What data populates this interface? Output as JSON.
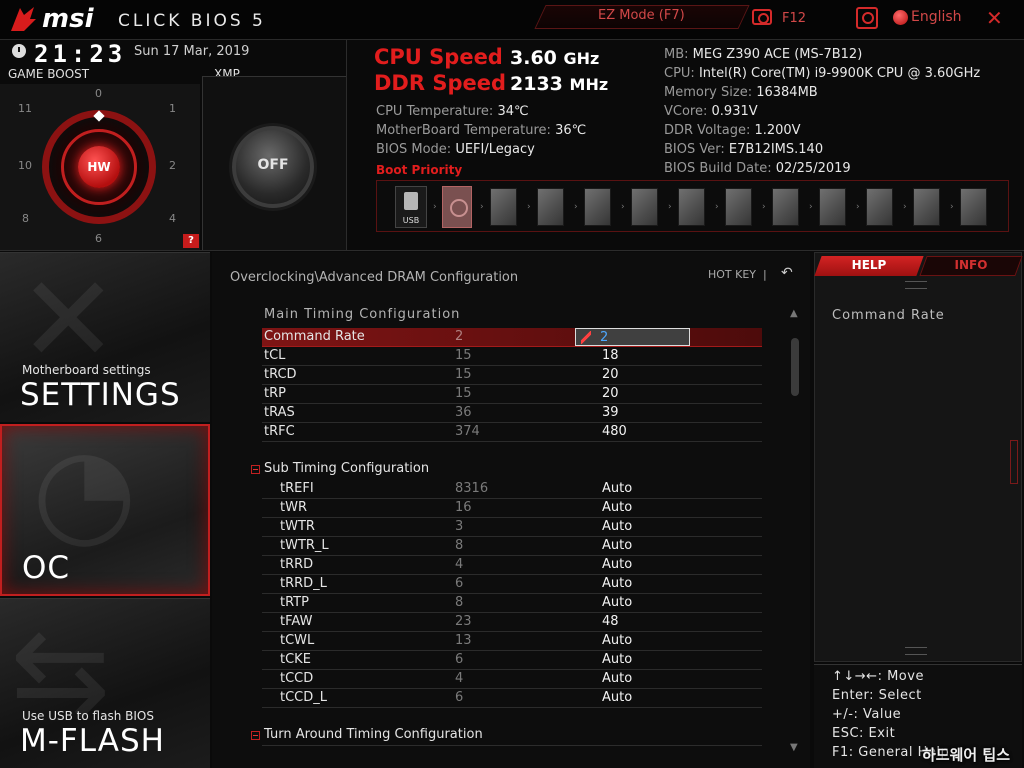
{
  "header": {
    "brand": "msi",
    "product": "CLICK BIOS 5",
    "ez_mode": "EZ Mode (F7)",
    "screenshot": "F12",
    "language": "English",
    "close": "✕"
  },
  "status": {
    "time": "21:23",
    "date": "Sun  17 Mar, 2019",
    "game_boost_label": "GAME BOOST",
    "xmp_label": "XMP",
    "dial_numbers": [
      "0",
      "1",
      "2",
      "4",
      "6",
      "8",
      "10",
      "11"
    ],
    "dial_core": "HW",
    "xmp_state": "OFF",
    "help_badge": "?"
  },
  "speeds": {
    "cpu_label": "CPU Speed",
    "cpu_value": "3.60",
    "cpu_unit": "GHz",
    "ddr_label": "DDR Speed",
    "ddr_value": "2133",
    "ddr_unit": "MHz"
  },
  "temps": {
    "cpu_temp_label": "CPU Temperature:",
    "cpu_temp_value": "34℃",
    "mb_temp_label": "MotherBoard Temperature:",
    "mb_temp_value": "36℃",
    "bios_mode_label": "BIOS Mode:",
    "bios_mode_value": "UEFI/",
    "bios_mode_legacy": "Legacy",
    "boot_priority": "Boot Priority",
    "usb_label": "USB"
  },
  "system": {
    "mb_label": "MB:",
    "mb_value": "MEG Z390 ACE (MS-7B12)",
    "cpu_label": "CPU:",
    "cpu_value": "Intel(R) Core(TM) i9-9900K CPU @ 3.60GHz",
    "mem_label": "Memory Size:",
    "mem_value": "16384MB",
    "vcore_label": "VCore:",
    "vcore_value": "0.931V",
    "ddrv_label": "DDR Voltage:",
    "ddrv_value": "1.200V",
    "biosver_label": "BIOS Ver:",
    "biosver_value": "E7B12IMS.140",
    "biosdate_label": "BIOS Build Date:",
    "biosdate_value": "02/25/2019"
  },
  "nav": {
    "settings_sub": "Motherboard settings",
    "settings_title": "SETTINGS",
    "oc_title": "OC",
    "mflash_sub": "Use USB to flash BIOS",
    "mflash_title": "M-FLASH"
  },
  "main": {
    "breadcrumb": "Overclocking\\Advanced DRAM Configuration",
    "hotkey": "HOT KEY",
    "hotkey_sep": "|",
    "undo": "↶",
    "main_timing_title": "Main  Timing  Configuration",
    "main_rows": [
      {
        "name": "Command Rate",
        "default": "2",
        "value": "2"
      },
      {
        "name": "tCL",
        "default": "15",
        "value": "18"
      },
      {
        "name": "tRCD",
        "default": "15",
        "value": "20"
      },
      {
        "name": "tRP",
        "default": "15",
        "value": "20"
      },
      {
        "name": "tRAS",
        "default": "36",
        "value": "39"
      },
      {
        "name": "tRFC",
        "default": "374",
        "value": "480"
      }
    ],
    "sub_timing_title": "Sub Timing Configuration",
    "sub_rows": [
      {
        "name": "tREFI",
        "default": "8316",
        "value": "Auto"
      },
      {
        "name": "tWR",
        "default": "16",
        "value": "Auto"
      },
      {
        "name": "tWTR",
        "default": "3",
        "value": "Auto"
      },
      {
        "name": "tWTR_L",
        "default": "8",
        "value": "Auto"
      },
      {
        "name": "tRRD",
        "default": "4",
        "value": "Auto"
      },
      {
        "name": "tRRD_L",
        "default": "6",
        "value": "Auto"
      },
      {
        "name": "tRTP",
        "default": "8",
        "value": "Auto"
      },
      {
        "name": "tFAW",
        "default": "23",
        "value": "48"
      },
      {
        "name": "tCWL",
        "default": "13",
        "value": "Auto"
      },
      {
        "name": "tCKE",
        "default": "6",
        "value": "Auto"
      },
      {
        "name": "tCCD",
        "default": "4",
        "value": "Auto"
      },
      {
        "name": "tCCD_L",
        "default": "6",
        "value": "Auto"
      }
    ],
    "turn_around_title": "Turn Around Timing Configuration"
  },
  "help": {
    "tab_help": "HELP",
    "tab_info": "INFO",
    "text": "Command  Rate",
    "keys": [
      "↑↓→←:  Move",
      "Enter:  Select",
      "+/-:  Value",
      "ESC:  Exit",
      "F1:  General  Help"
    ],
    "watermark": "하드웨어 팁스"
  },
  "colors": {
    "accent": "#e21d1d",
    "background": "#0a0a0a",
    "selected_row": "#7e1414"
  }
}
